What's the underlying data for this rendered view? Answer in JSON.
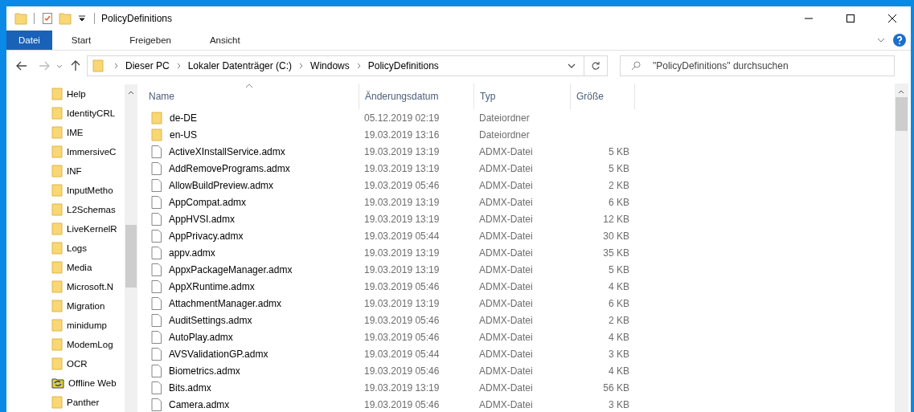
{
  "window": {
    "title": "PolicyDefinitions"
  },
  "ribbon_tabs": [
    {
      "label": "Datei",
      "selected": true
    },
    {
      "label": "Start",
      "selected": false
    },
    {
      "label": "Freigeben",
      "selected": false
    },
    {
      "label": "Ansicht",
      "selected": false
    }
  ],
  "address_bar": {
    "breadcrumbs": [
      "Dieser PC",
      "Lokaler Datenträger (C:)",
      "Windows",
      "PolicyDefinitions"
    ]
  },
  "search": {
    "placeholder": "\"PolicyDefinitions\" durchsuchen"
  },
  "sidebar": {
    "items": [
      {
        "label": "Help",
        "kind": "folder"
      },
      {
        "label": "IdentityCRL",
        "kind": "folder"
      },
      {
        "label": "IME",
        "kind": "folder"
      },
      {
        "label": "ImmersiveC",
        "kind": "folder"
      },
      {
        "label": "INF",
        "kind": "folder"
      },
      {
        "label": "InputMetho",
        "kind": "folder"
      },
      {
        "label": "L2Schemas",
        "kind": "folder"
      },
      {
        "label": "LiveKernelR",
        "kind": "folder"
      },
      {
        "label": "Logs",
        "kind": "folder"
      },
      {
        "label": "Media",
        "kind": "folder"
      },
      {
        "label": "Microsoft.N",
        "kind": "folder"
      },
      {
        "label": "Migration",
        "kind": "folder"
      },
      {
        "label": "minidump",
        "kind": "folder"
      },
      {
        "label": "ModemLog",
        "kind": "folder"
      },
      {
        "label": "OCR",
        "kind": "folder"
      },
      {
        "label": "Offline Web",
        "kind": "sync"
      },
      {
        "label": "Panther",
        "kind": "folder"
      }
    ]
  },
  "table": {
    "columns": [
      "Name",
      "Änderungsdatum",
      "Typ",
      "Größe"
    ],
    "rows": [
      {
        "kind": "folder",
        "name": "de-DE",
        "date": "05.12.2019 02:19",
        "type": "Dateiordner"
      },
      {
        "kind": "folder",
        "name": "en-US",
        "date": "19.03.2019 13:16",
        "type": "Dateiordner"
      },
      {
        "kind": "file",
        "name": "ActiveXInstallService.admx",
        "date": "19.03.2019 13:19",
        "type": "ADMX-Datei",
        "size": "5 KB"
      },
      {
        "kind": "file",
        "name": "AddRemovePrograms.admx",
        "date": "19.03.2019 13:19",
        "type": "ADMX-Datei",
        "size": "5 KB"
      },
      {
        "kind": "file",
        "name": "AllowBuildPreview.admx",
        "date": "19.03.2019 05:46",
        "type": "ADMX-Datei",
        "size": "2 KB"
      },
      {
        "kind": "file",
        "name": "AppCompat.admx",
        "date": "19.03.2019 13:19",
        "type": "ADMX-Datei",
        "size": "6 KB"
      },
      {
        "kind": "file",
        "name": "AppHVSI.admx",
        "date": "19.03.2019 13:19",
        "type": "ADMX-Datei",
        "size": "12 KB"
      },
      {
        "kind": "file",
        "name": "AppPrivacy.admx",
        "date": "19.03.2019 05:44",
        "type": "ADMX-Datei",
        "size": "30 KB"
      },
      {
        "kind": "file",
        "name": "appv.admx",
        "date": "19.03.2019 13:19",
        "type": "ADMX-Datei",
        "size": "35 KB"
      },
      {
        "kind": "file",
        "name": "AppxPackageManager.admx",
        "date": "19.03.2019 13:19",
        "type": "ADMX-Datei",
        "size": "5 KB"
      },
      {
        "kind": "file",
        "name": "AppXRuntime.admx",
        "date": "19.03.2019 05:46",
        "type": "ADMX-Datei",
        "size": "4 KB"
      },
      {
        "kind": "file",
        "name": "AttachmentManager.admx",
        "date": "19.03.2019 13:19",
        "type": "ADMX-Datei",
        "size": "6 KB"
      },
      {
        "kind": "file",
        "name": "AuditSettings.admx",
        "date": "19.03.2019 05:46",
        "type": "ADMX-Datei",
        "size": "2 KB"
      },
      {
        "kind": "file",
        "name": "AutoPlay.admx",
        "date": "19.03.2019 05:46",
        "type": "ADMX-Datei",
        "size": "4 KB"
      },
      {
        "kind": "file",
        "name": "AVSValidationGP.admx",
        "date": "19.03.2019 05:44",
        "type": "ADMX-Datei",
        "size": "3 KB"
      },
      {
        "kind": "file",
        "name": "Biometrics.admx",
        "date": "19.03.2019 05:46",
        "type": "ADMX-Datei",
        "size": "4 KB"
      },
      {
        "kind": "file",
        "name": "Bits.admx",
        "date": "19.03.2019 13:19",
        "type": "ADMX-Datei",
        "size": "56 KB"
      },
      {
        "kind": "file",
        "name": "Camera.admx",
        "date": "19.03.2019 05:46",
        "type": "ADMX-Datei",
        "size": "3 KB"
      }
    ]
  }
}
